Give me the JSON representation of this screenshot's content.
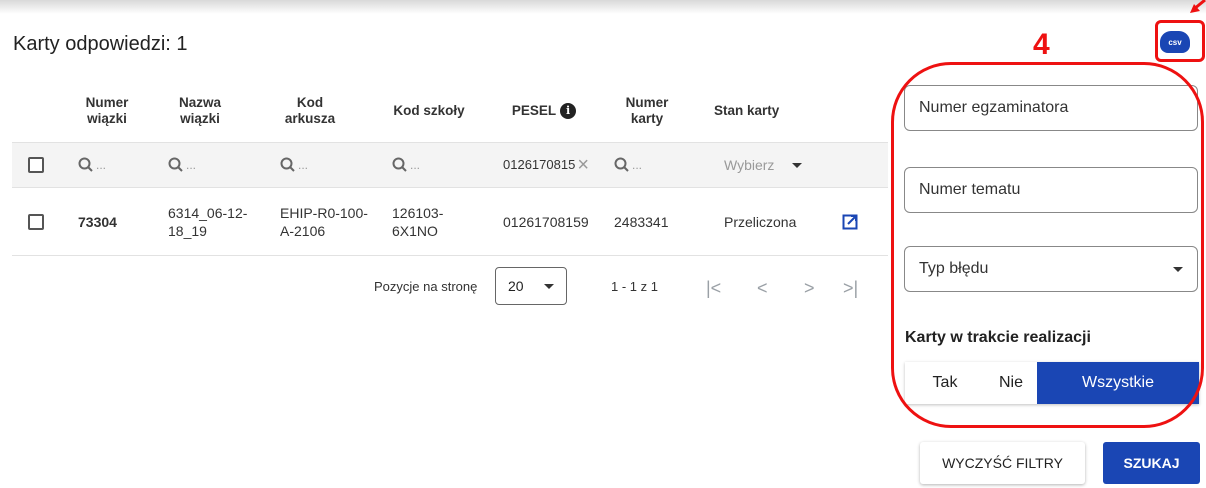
{
  "header": {
    "title": "Karty odpowiedzi: 1"
  },
  "table": {
    "columns": [
      "Numer\nwiązki",
      "Nazwa\nwiązki",
      "Kod\narkusza",
      "Kod szkoły",
      "PESEL",
      "Numer\nkarty",
      "Stan karty"
    ],
    "filters": {
      "search_placeholder": "...",
      "pesel_value": "0126170815",
      "state_placeholder": "Wybierz"
    },
    "rows": [
      {
        "numer_wiazki": "73304",
        "nazwa_wiazki": "6314_06-12-18_19",
        "kod_arkusza": "EHIP-R0-100-A-2106",
        "kod_szkoly": "126103-6X1NO",
        "pesel": "01261708159",
        "numer_karty": "2483341",
        "stan_karty": "Przeliczona"
      }
    ]
  },
  "pagination": {
    "page_size_label": "Pozycje na stronę",
    "page_size": "20",
    "range": "1 - 1 z 1"
  },
  "filters_panel": {
    "examiner_label": "Numer egzaminatora",
    "topic_label": "Numer tematu",
    "error_type_label": "Typ błędu",
    "in_progress_title": "Karty w trakcie realizacji",
    "toggle_options": [
      "Tak",
      "Nie",
      "Wszystkie"
    ],
    "toggle_selected": "Wszystkie"
  },
  "buttons": {
    "clear_filters": "WYCZYŚĆ FILTRY",
    "search": "SZUKAJ",
    "csv": "csv"
  },
  "annotation": {
    "number": "4",
    "color": "#ee1111"
  },
  "colors": {
    "primary": "#1a46b4"
  }
}
